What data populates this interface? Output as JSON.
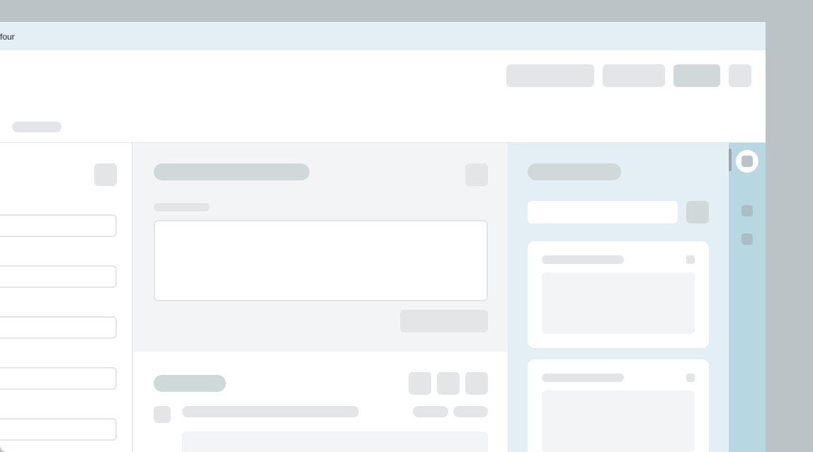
{
  "window": {
    "tab_label": "four"
  },
  "colors": {
    "background": "#bcc3c7",
    "topbar": "#e3eff5",
    "skeleton": "#e3e5e6",
    "skeleton_dark": "#d1d8da",
    "panel_light": "#f3f4f5",
    "right_panel": "#e3eff5",
    "rail": "#b8d8e1"
  },
  "rail": {
    "items": [
      {
        "icon": "square-icon",
        "selected": true
      },
      {
        "icon": "square-icon",
        "selected": false
      },
      {
        "icon": "square-icon",
        "selected": false
      }
    ]
  }
}
